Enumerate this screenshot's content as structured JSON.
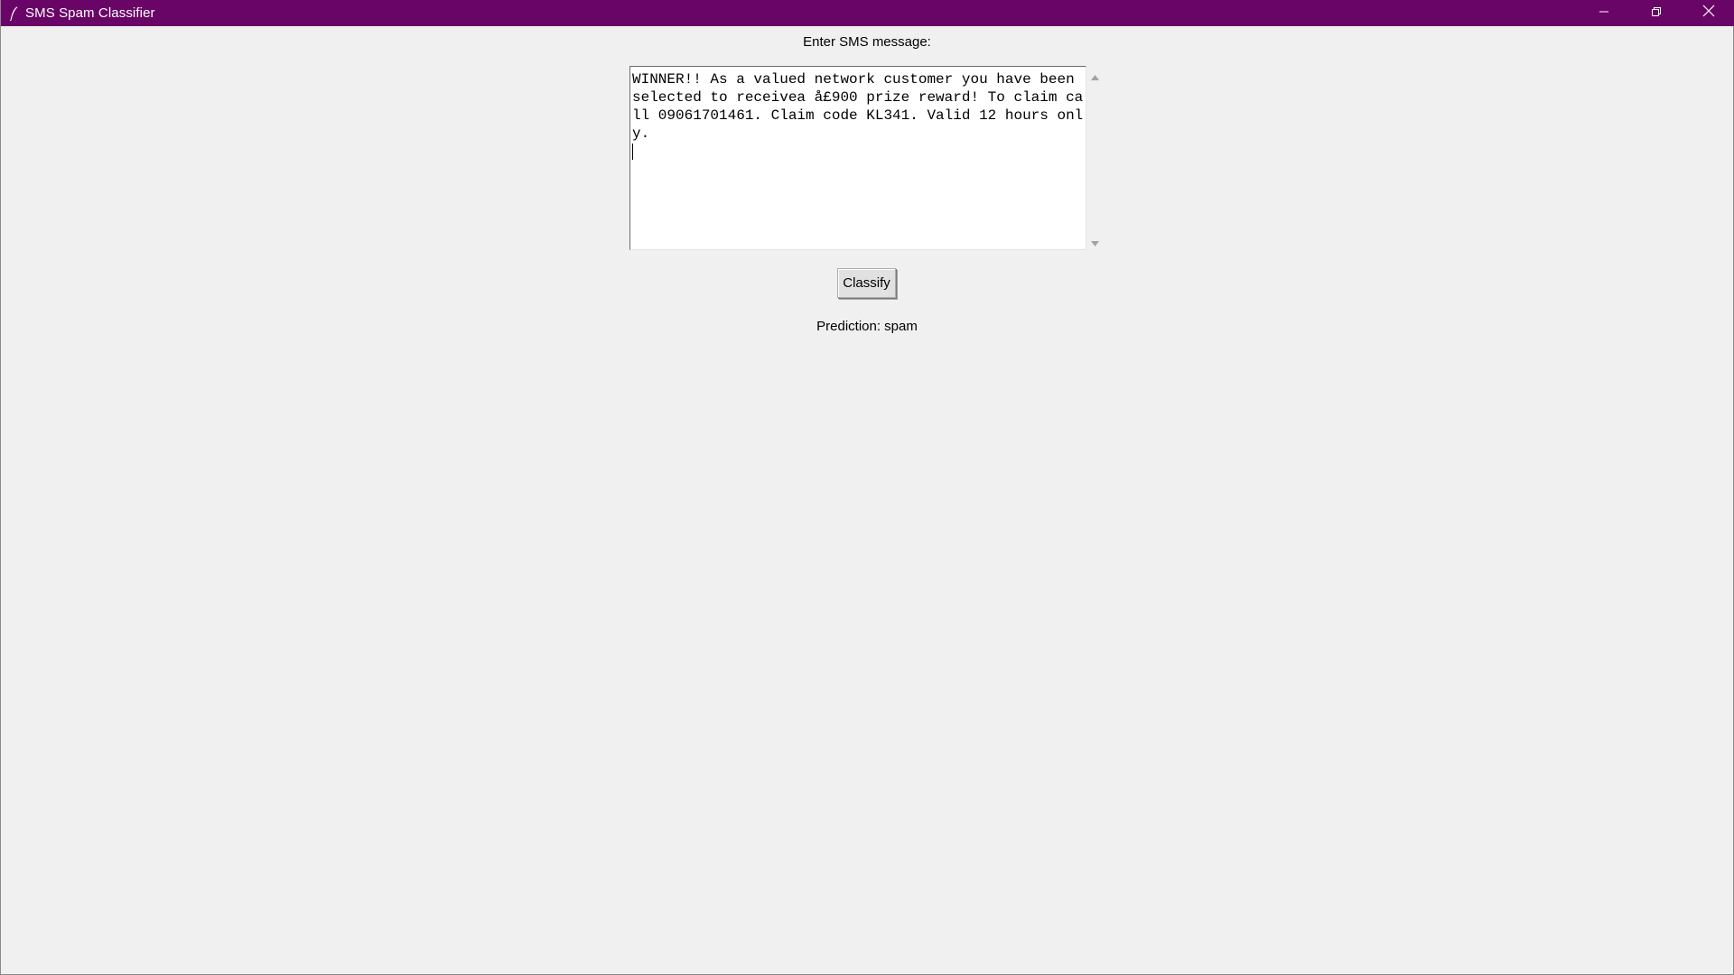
{
  "window": {
    "title": "SMS Spam Classifier",
    "titlebar_color": "#6a0568",
    "caption_buttons": [
      "minimize-icon",
      "restore-icon",
      "close-icon"
    ]
  },
  "form": {
    "prompt_label": "Enter SMS message:",
    "message_text": "WINNER!! As a valued network customer you have been selected to receivea å£900 prize reward! To claim call 09061701461. Claim code KL341. Valid 12 hours only.",
    "classify_label": "Classify",
    "prediction_text": "Prediction: spam"
  }
}
